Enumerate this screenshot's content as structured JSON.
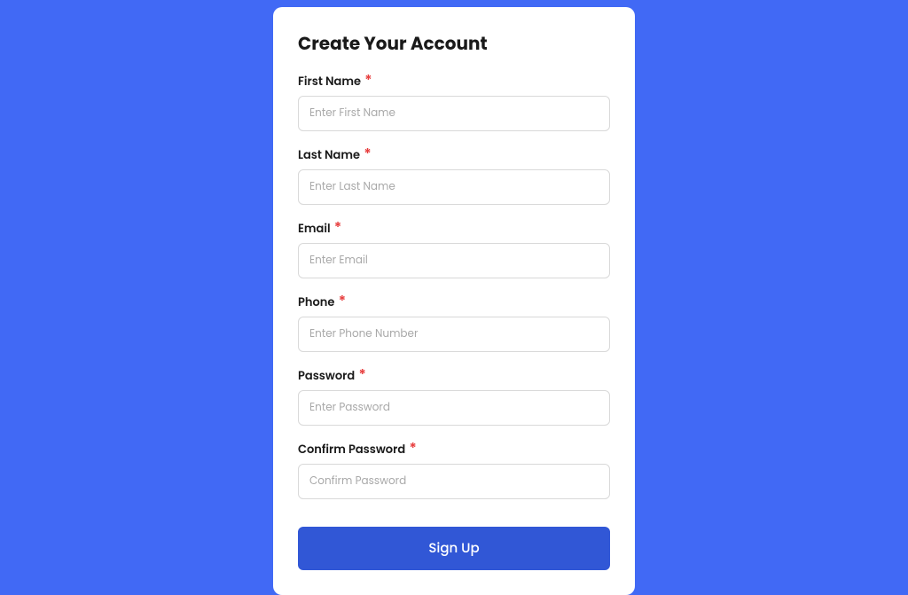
{
  "form": {
    "title": "Create Your Account",
    "required_mark": "*",
    "fields": [
      {
        "label": "First Name",
        "placeholder": "Enter First Name"
      },
      {
        "label": "Last Name",
        "placeholder": "Enter Last Name"
      },
      {
        "label": "Email",
        "placeholder": "Enter Email"
      },
      {
        "label": "Phone",
        "placeholder": "Enter Phone Number"
      },
      {
        "label": "Password",
        "placeholder": "Enter Password"
      },
      {
        "label": "Confirm Password",
        "placeholder": "Confirm Password"
      }
    ],
    "submit_label": "Sign Up"
  }
}
